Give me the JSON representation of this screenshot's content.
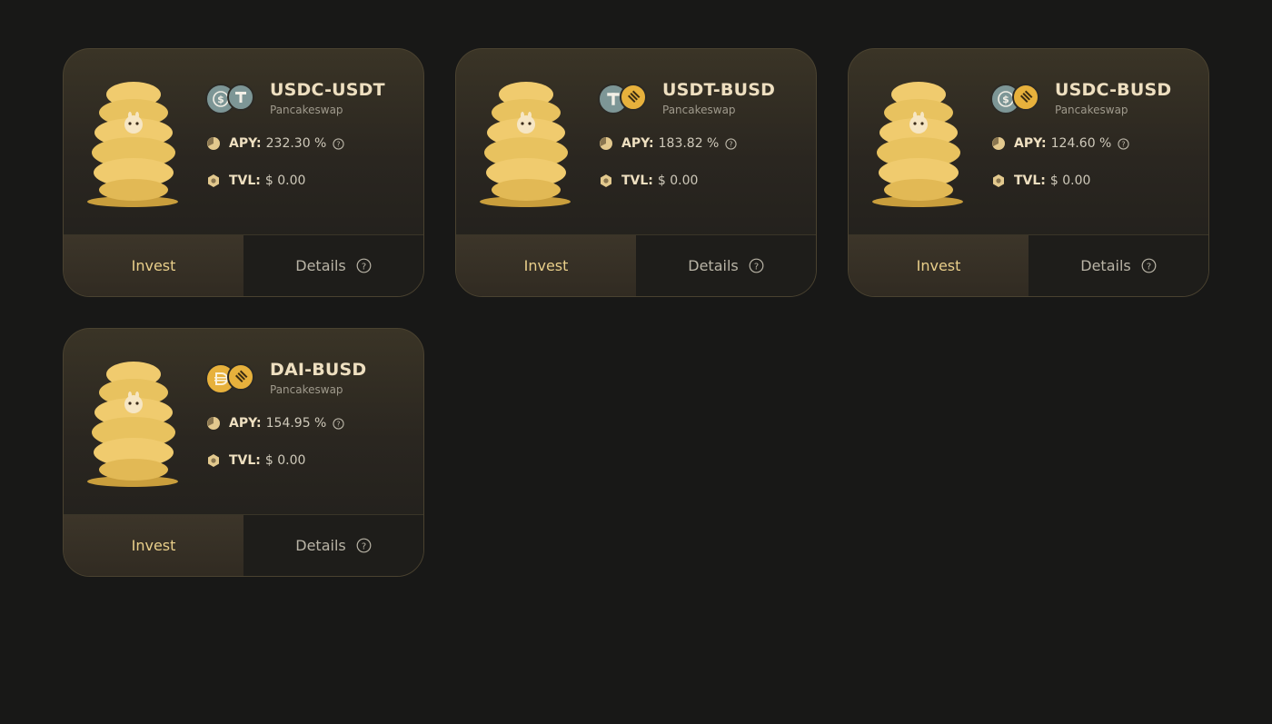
{
  "pools": [
    {
      "name": "USDC-USDT",
      "platform": "Pancakeswap",
      "apy_label": "APY:",
      "apy": "232.30 %",
      "tvl_label": "TVL:",
      "tvl": "$ 0.00",
      "invest": "Invest",
      "details": "Details",
      "token_a": "usdc-icon",
      "token_b": "usdt-icon"
    },
    {
      "name": "USDT-BUSD",
      "platform": "Pancakeswap",
      "apy_label": "APY:",
      "apy": "183.82 %",
      "tvl_label": "TVL:",
      "tvl": "$ 0.00",
      "invest": "Invest",
      "details": "Details",
      "token_a": "usdt-icon",
      "token_b": "busd-icon"
    },
    {
      "name": "USDC-BUSD",
      "platform": "Pancakeswap",
      "apy_label": "APY:",
      "apy": "124.60 %",
      "tvl_label": "TVL:",
      "tvl": "$ 0.00",
      "invest": "Invest",
      "details": "Details",
      "token_a": "usdc-icon",
      "token_b": "busd-icon"
    },
    {
      "name": "DAI-BUSD",
      "platform": "Pancakeswap",
      "apy_label": "APY:",
      "apy": "154.95 %",
      "tvl_label": "TVL:",
      "tvl": "$ 0.00",
      "invest": "Invest",
      "details": "Details",
      "token_a": "dai-icon",
      "token_b": "busd-icon"
    }
  ],
  "colors": {
    "background": "#181817",
    "gold": "#e8c25f",
    "title": "#eedfc0",
    "usdc": "#7d9696",
    "usdt": "#7d9696",
    "busd": "#e7b13c",
    "dai": "#e7b13c"
  }
}
